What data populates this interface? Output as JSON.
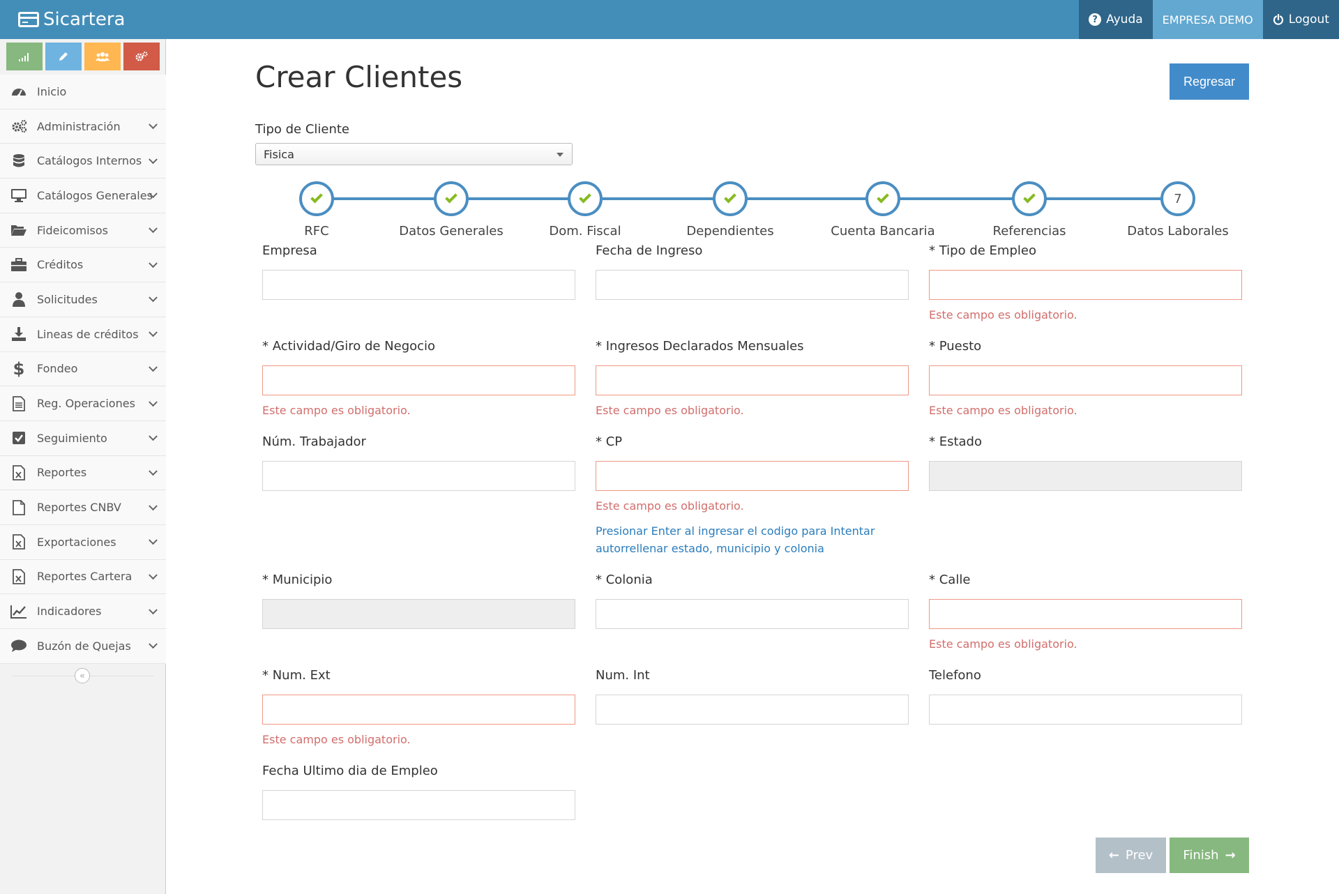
{
  "app": {
    "title": "Sicartera"
  },
  "nav": {
    "help": "Ayuda",
    "company": "EMPRESA DEMO",
    "logout": "Logout"
  },
  "sidebar": {
    "shortcuts": [
      {
        "icon": "signal-icon",
        "color": "#87b87f"
      },
      {
        "icon": "pencil-icon",
        "color": "#6fb3e0"
      },
      {
        "icon": "users-icon",
        "color": "#ffb752"
      },
      {
        "icon": "cogs-icon",
        "color": "#d15b47"
      }
    ],
    "items": [
      {
        "label": "Inicio",
        "icon": "dashboard-icon"
      },
      {
        "label": "Administración",
        "icon": "cogs-icon"
      },
      {
        "label": "Catálogos Internos",
        "icon": "database-icon"
      },
      {
        "label": "Catálogos Generales",
        "icon": "desktop-icon"
      },
      {
        "label": "Fideicomisos",
        "icon": "folder-open-icon"
      },
      {
        "label": "Créditos",
        "icon": "briefcase-icon"
      },
      {
        "label": "Solicitudes",
        "icon": "user-icon"
      },
      {
        "label": "Lineas de créditos",
        "icon": "download-icon"
      },
      {
        "label": "Fondeo",
        "icon": "dollar-icon"
      },
      {
        "label": "Reg. Operaciones",
        "icon": "file-text-icon"
      },
      {
        "label": "Seguimiento",
        "icon": "check-square-icon"
      },
      {
        "label": "Reportes",
        "icon": "file-excel-icon"
      },
      {
        "label": "Reportes CNBV",
        "icon": "file-icon"
      },
      {
        "label": "Exportaciones",
        "icon": "file-excel-icon"
      },
      {
        "label": "Reportes Cartera",
        "icon": "file-excel-icon"
      },
      {
        "label": "Indicadores",
        "icon": "line-chart-icon"
      },
      {
        "label": "Buzón de Quejas",
        "icon": "comment-icon"
      }
    ]
  },
  "page": {
    "title": "Crear Clientes",
    "back_button": "Regresar",
    "tipo_cliente": {
      "label": "Tipo de Cliente",
      "value": "Fisica"
    }
  },
  "wizard": {
    "steps": [
      {
        "label": "RFC",
        "done": true
      },
      {
        "label": "Datos Generales",
        "done": true
      },
      {
        "label": "Dom. Fiscal",
        "done": true
      },
      {
        "label": "Dependientes",
        "done": true
      },
      {
        "label": "Cuenta Bancaria",
        "done": true
      },
      {
        "label": "Referencias",
        "done": true
      },
      {
        "label": "Datos Laborales",
        "done": false,
        "number": "7"
      }
    ],
    "prev": "Prev",
    "finish": "Finish"
  },
  "form": {
    "error": "Este campo es obligatorio.",
    "cp_hint": "Presionar Enter al ingresar el codigo para Intentar autorrellenar estado, municipio y colonia",
    "fields": {
      "empresa": {
        "label": "Empresa",
        "value": ""
      },
      "fecha_ingreso": {
        "label": "Fecha de Ingreso",
        "value": ""
      },
      "tipo_empleo": {
        "label": "* Tipo de Empleo",
        "value": ""
      },
      "actividad": {
        "label": "* Actividad/Giro de Negocio",
        "value": ""
      },
      "ingresos": {
        "label": "* Ingresos Declarados Mensuales",
        "value": ""
      },
      "puesto": {
        "label": "* Puesto",
        "value": ""
      },
      "num_trabajador": {
        "label": "Núm. Trabajador",
        "value": ""
      },
      "cp": {
        "label": "* CP",
        "value": ""
      },
      "estado": {
        "label": "* Estado",
        "value": ""
      },
      "municipio": {
        "label": "* Municipio",
        "value": ""
      },
      "colonia": {
        "label": "* Colonia",
        "value": ""
      },
      "calle": {
        "label": "* Calle",
        "value": ""
      },
      "num_ext": {
        "label": "* Num. Ext",
        "value": ""
      },
      "num_int": {
        "label": "Num. Int",
        "value": ""
      },
      "telefono": {
        "label": "Telefono",
        "value": ""
      },
      "fecha_ultimo": {
        "label": "Fecha Ultimo dia de Empleo",
        "value": ""
      }
    }
  },
  "colors": {
    "topbar": "#438eb9",
    "step_line": "#4a8ec2",
    "check": "#87ba21",
    "error": "#d16e6c",
    "primary": "#428bca",
    "success": "#87b87f"
  }
}
